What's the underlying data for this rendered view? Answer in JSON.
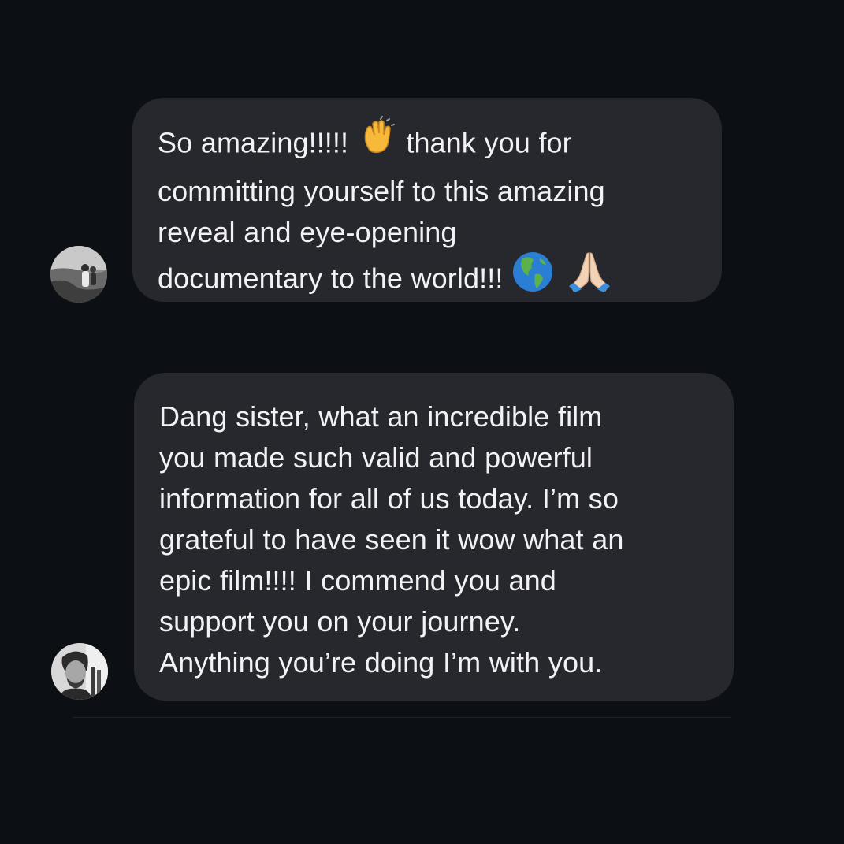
{
  "messages": [
    {
      "lines": [
        [
          "So amazing!!!!! ",
          "clapping-hands-emoji",
          " thank you for"
        ],
        [
          "committing yourself to this amazing"
        ],
        [
          "reveal and eye-opening"
        ],
        [
          "documentary to the world!!! ",
          "globe-americas-emoji",
          " ",
          "folded-hands-emoji"
        ]
      ],
      "avatar": "avatar-beach-photo"
    },
    {
      "lines": [
        [
          "Dang sister, what an incredible film"
        ],
        [
          "you made such valid and powerful"
        ],
        [
          "information for all of us today. I’m so"
        ],
        [
          "grateful to have seen it wow what an"
        ],
        [
          "epic film!!!! I commend you and"
        ],
        [
          "support you on your journey."
        ],
        [
          "Anything you’re doing I’m with you."
        ]
      ],
      "avatar": "avatar-man-portrait"
    }
  ],
  "colors": {
    "background": "#0c0f13",
    "bubble": "#26282e",
    "text": "#f2f2f4"
  }
}
